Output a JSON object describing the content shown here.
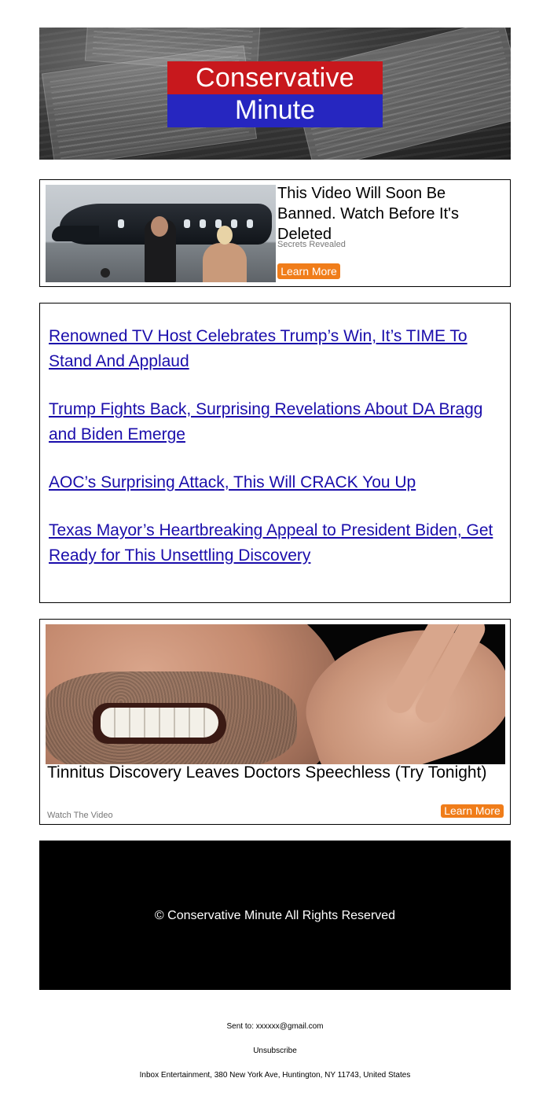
{
  "header": {
    "logo_line1": "Conservative",
    "logo_line2": "Minute",
    "colors": {
      "logo_red": "#c8181d",
      "logo_blue": "#2626c0"
    }
  },
  "ad_top": {
    "title": "This Video Will Soon Be Banned. Watch Before It's Deleted",
    "sponsor": "Secrets Revealed",
    "button_label": "Learn More",
    "button_color": "#f07d1a"
  },
  "articles": [
    {
      "text": "Renowned TV Host Celebrates Trump’s Win, It’s TIME To Stand And Applaud"
    },
    {
      "text": "Trump Fights Back, Surprising Revelations About DA Bragg and Biden Emerge"
    },
    {
      "text": "AOC’s Surprising Attack, This Will CRACK You Up"
    },
    {
      "text": "Texas Mayor’s Heartbreaking Appeal to President Biden, Get Ready for This Unsettling Discovery"
    }
  ],
  "ad_bottom": {
    "title": "Tinnitus Discovery Leaves Doctors Speechless (Try Tonight)",
    "sponsor": "Watch The Video",
    "button_label": "Learn More"
  },
  "footer": {
    "copyright": "© Conservative Minute All Rights Reserved"
  },
  "meta": {
    "sent_to": "Sent to: xxxxxx@gmail.com",
    "unsubscribe": "Unsubscribe",
    "address": "Inbox Entertainment, 380 New York Ave, Huntington, NY 11743, United States"
  }
}
